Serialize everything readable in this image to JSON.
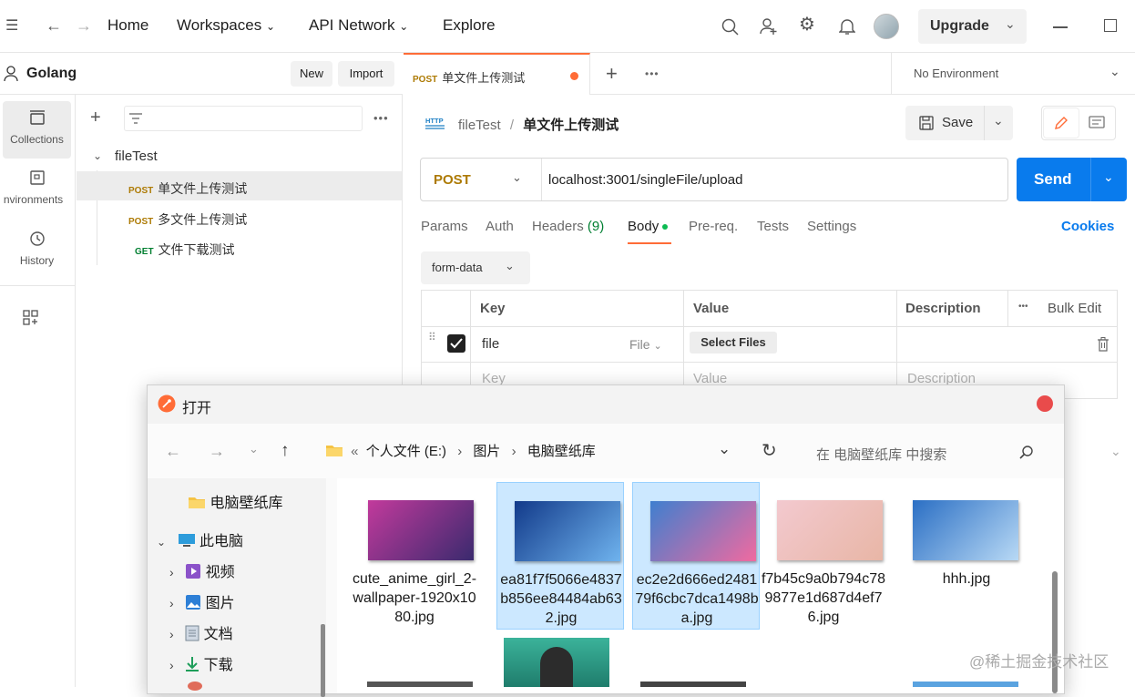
{
  "topbar": {
    "nav": [
      "Home",
      "Workspaces",
      "API Network",
      "Explore"
    ],
    "upgrade_label": "Upgrade"
  },
  "workspace": {
    "name": "Golang",
    "new_label": "New",
    "import_label": "Import"
  },
  "sidebar": {
    "items": [
      {
        "label": "Collections"
      },
      {
        "label": "nvironments"
      },
      {
        "label": "History"
      }
    ]
  },
  "tree": {
    "collection": "fileTest",
    "requests": [
      {
        "method": "POST",
        "name": "单文件上传测试",
        "selected": true
      },
      {
        "method": "POST",
        "name": "多文件上传测试",
        "selected": false
      },
      {
        "method": "GET",
        "name": "文件下载测试",
        "selected": false
      }
    ]
  },
  "tab": {
    "method": "POST",
    "name": "单文件上传测试",
    "environment": "No Environment"
  },
  "breadcrumb": {
    "collection": "fileTest",
    "separator": "/",
    "request": "单文件上传测试"
  },
  "request": {
    "save_label": "Save",
    "method": "POST",
    "url": "localhost:3001/singleFile/upload",
    "send_label": "Send"
  },
  "subtabs": {
    "params": "Params",
    "auth": "Auth",
    "headers": "Headers",
    "headers_count": "(9)",
    "body": "Body",
    "prereq": "Pre-req.",
    "tests": "Tests",
    "settings": "Settings",
    "cookies": "Cookies"
  },
  "body_mode": "form-data",
  "form_table": {
    "headers": {
      "key": "Key",
      "value": "Value",
      "description": "Description",
      "bulk_edit": "Bulk Edit"
    },
    "rows": [
      {
        "key": "file",
        "type": "File",
        "select_label": "Select Files"
      }
    ],
    "placeholders": {
      "key": "Key",
      "value": "Value",
      "description": "Description"
    }
  },
  "dialog": {
    "title": "打开",
    "path": {
      "prefix": "«",
      "segments": [
        "个人文件 (E:)",
        "图片",
        "电脑壁纸库"
      ]
    },
    "search_placeholder": "在 电脑壁纸库 中搜索",
    "nav": [
      {
        "label": "电脑壁纸库",
        "icon": "folder-icon"
      },
      {
        "label": "此电脑",
        "icon": "computer-icon"
      },
      {
        "label": "视频",
        "icon": "video-icon"
      },
      {
        "label": "图片",
        "icon": "pictures-icon"
      },
      {
        "label": "文档",
        "icon": "document-icon"
      },
      {
        "label": "下载",
        "icon": "download-icon"
      }
    ],
    "files": [
      {
        "name": "cute_anime_girl_2-wallpaper-1920x1080.jpg",
        "selected": false,
        "colors": [
          "#c23a9c",
          "#3a2a6e"
        ]
      },
      {
        "name": "ea81f7f5066e4837b856ee84484ab632.jpg",
        "selected": true,
        "colors": [
          "#123a8a",
          "#6fb3ee"
        ]
      },
      {
        "name": "ec2e2d666ed248179f6cbc7dca1498ba.jpg",
        "selected": true,
        "colors": [
          "#3f7fcf",
          "#f06aa0"
        ]
      },
      {
        "name": "f7b45c9a0b794c789877e1d687d4ef76.jpg",
        "selected": false,
        "colors": [
          "#f3c9cf",
          "#e8b6a6"
        ]
      },
      {
        "name": "hhh.jpg",
        "selected": false,
        "colors": [
          "#2b6fc4",
          "#b8d9f5"
        ]
      }
    ]
  },
  "watermark": "@稀土掘金技术社区"
}
